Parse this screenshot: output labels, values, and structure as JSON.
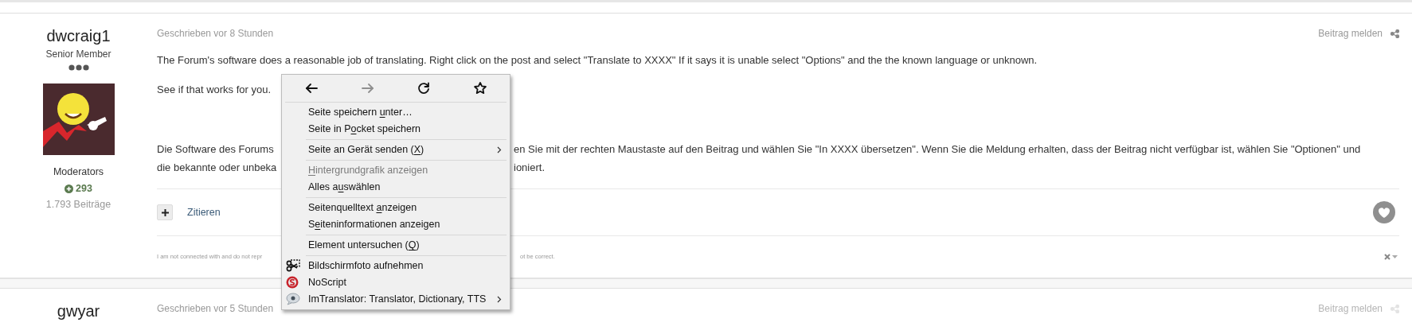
{
  "posts": [
    {
      "active": true,
      "author": "dwcraig1",
      "rank": "Senior Member",
      "group": "Moderators",
      "reputation": "293",
      "post_count": "1.793 Beiträge",
      "timestamp": "Geschrieben vor 8 Stunden",
      "report": "Beitrag melden",
      "body_lines": [
        {
          "segments": [
            "The Forum's software does a reasonable job of translating. Right click on the post and select \"Translate to XXXX\" If it says it is unable select \"Options\" and the the known language or unknown."
          ]
        },
        {
          "segments": [
            "See if that works for you."
          ]
        },
        {
          "segments": [
            "Die Software des Forums",
            "en Sie mit der rechten Maustaste auf den Beitrag und wählen Sie \"In XXXX übersetzen\". Wenn Sie die Meldung erhalten, dass der Beitrag nicht verfügbar ist, wählen Sie \"Optionen\" und"
          ]
        },
        {
          "segments": [
            "die bekannte oder unbeka",
            "ioniert."
          ]
        }
      ],
      "quote_label": "Zitieren",
      "signature": [
        "I am not connected with and do not repr",
        "ot be correct."
      ]
    },
    {
      "active": false,
      "author": "gwyar",
      "timestamp": "Geschrieben vor 5 Stunden",
      "report": "Beitrag melden"
    }
  ],
  "context_menu": {
    "nav": [
      {
        "disabled": false
      },
      {
        "disabled": true
      },
      {
        "disabled": false
      },
      {
        "disabled": false
      }
    ],
    "groups": [
      {
        "with_icons": false,
        "items": [
          {
            "disabled": false,
            "submenu": false,
            "label": [
              {
                "text": "Seite speichern ",
                "underline": false
              },
              {
                "text": "u",
                "underline": true
              },
              {
                "text": "nter…",
                "underline": false
              }
            ]
          },
          {
            "disabled": false,
            "submenu": false,
            "label": [
              {
                "text": "Seite in P",
                "underline": false
              },
              {
                "text": "o",
                "underline": true
              },
              {
                "text": "cket speichern",
                "underline": false
              }
            ]
          }
        ]
      },
      {
        "with_icons": false,
        "items": [
          {
            "disabled": false,
            "submenu": true,
            "label": [
              {
                "text": "Seite an Gerät senden (",
                "underline": false
              },
              {
                "text": "X",
                "underline": true
              },
              {
                "text": ")",
                "underline": false
              }
            ]
          }
        ]
      },
      {
        "with_icons": false,
        "items": [
          {
            "disabled": true,
            "submenu": false,
            "label": [
              {
                "text": "H",
                "underline": true
              },
              {
                "text": "intergrundgrafik anzeigen",
                "underline": false
              }
            ]
          },
          {
            "disabled": false,
            "submenu": false,
            "label": [
              {
                "text": "Alles a",
                "underline": false
              },
              {
                "text": "u",
                "underline": true
              },
              {
                "text": "swählen",
                "underline": false
              }
            ]
          }
        ]
      },
      {
        "with_icons": false,
        "items": [
          {
            "disabled": false,
            "submenu": false,
            "label": [
              {
                "text": "Seitenquelltext ",
                "underline": false
              },
              {
                "text": "a",
                "underline": true
              },
              {
                "text": "nzeigen",
                "underline": false
              }
            ]
          },
          {
            "disabled": false,
            "submenu": false,
            "label": [
              {
                "text": "S",
                "underline": false
              },
              {
                "text": "e",
                "underline": true
              },
              {
                "text": "iteninformationen anzeigen",
                "underline": false
              }
            ]
          }
        ]
      },
      {
        "with_icons": false,
        "items": [
          {
            "disabled": false,
            "submenu": false,
            "label": [
              {
                "text": "Element untersuchen (",
                "underline": false
              },
              {
                "text": "Q",
                "underline": true
              },
              {
                "text": ")",
                "underline": false
              }
            ]
          }
        ]
      },
      {
        "with_icons": true,
        "items": [
          {
            "disabled": false,
            "submenu": false,
            "label": [
              {
                "text": "Bildschirmfoto aufnehmen",
                "underline": false
              }
            ]
          },
          {
            "disabled": false,
            "submenu": false,
            "label": [
              {
                "text": "NoScript",
                "underline": false
              }
            ]
          },
          {
            "disabled": false,
            "submenu": true,
            "label": [
              {
                "text": "ImTranslator: Translator, Dictionary, TTS",
                "underline": false
              }
            ]
          }
        ]
      }
    ]
  }
}
